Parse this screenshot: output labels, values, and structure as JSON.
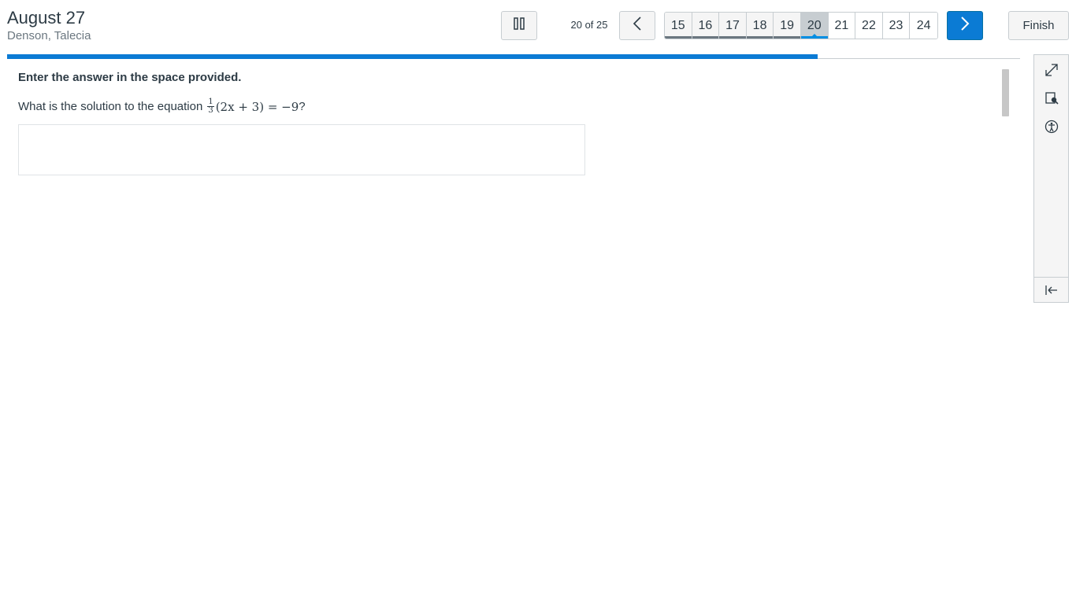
{
  "header": {
    "title": "August 27",
    "student": "Denson, Talecia"
  },
  "nav": {
    "counter": "20 of 25",
    "pages": [
      {
        "label": "15",
        "state": "answered"
      },
      {
        "label": "16",
        "state": "answered"
      },
      {
        "label": "17",
        "state": "answered"
      },
      {
        "label": "18",
        "state": "answered"
      },
      {
        "label": "19",
        "state": "answered"
      },
      {
        "label": "20",
        "state": "current"
      },
      {
        "label": "21",
        "state": "unanswered"
      },
      {
        "label": "22",
        "state": "unanswered"
      },
      {
        "label": "23",
        "state": "unanswered"
      },
      {
        "label": "24",
        "state": "unanswered"
      }
    ],
    "finish_label": "Finish",
    "progress_fraction": 0.8
  },
  "question": {
    "instruction": "Enter the answer in the space provided.",
    "prompt": "What is the solution to the equation",
    "equation": {
      "numerator": "1",
      "denominator": "3",
      "body": "(2x + 3) = −9",
      "suffix": "?"
    },
    "answer_value": ""
  },
  "icons": {
    "pause": "pause-icon",
    "prev": "chevron-left-icon",
    "next": "chevron-right-icon",
    "fullscreen": "expand-icon",
    "magnifier": "magnifier-icon",
    "accessibility": "accessibility-icon",
    "collapse": "collapse-panel-icon"
  },
  "colors": {
    "accent": "#0b7bd4",
    "text": "#2d3b45",
    "muted": "#6b7780"
  }
}
